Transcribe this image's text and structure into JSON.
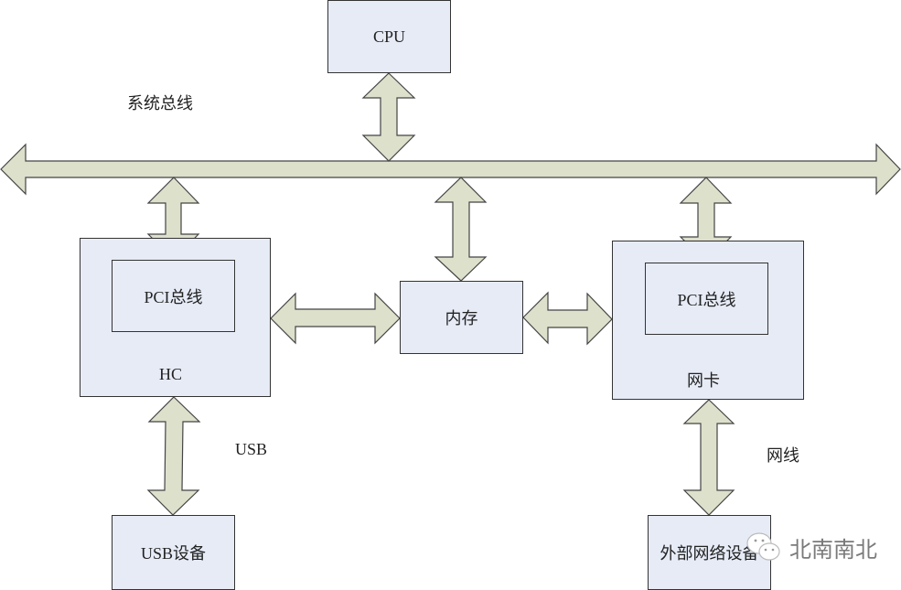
{
  "diagram": {
    "nodes": {
      "cpu": "CPU",
      "hc": "HC",
      "hc_pci": "PCI总线",
      "memory": "内存",
      "nic": "网卡",
      "nic_pci": "PCI总线",
      "usb_device": "USB设备",
      "external_net_device": "外部网络设备"
    },
    "labels": {
      "system_bus": "系统总线",
      "usb": "USB",
      "network_cable": "网线"
    },
    "edges": [
      {
        "from": "cpu",
        "to": "system_bus",
        "type": "bidirectional"
      },
      {
        "from": "system_bus",
        "to": "hc_pci",
        "type": "bidirectional"
      },
      {
        "from": "system_bus",
        "to": "memory",
        "type": "bidirectional"
      },
      {
        "from": "system_bus",
        "to": "nic_pci",
        "type": "bidirectional"
      },
      {
        "from": "hc",
        "to": "memory",
        "type": "bidirectional"
      },
      {
        "from": "memory",
        "to": "nic",
        "type": "bidirectional"
      },
      {
        "from": "hc",
        "to": "usb_device",
        "type": "bidirectional",
        "label": "USB"
      },
      {
        "from": "nic",
        "to": "external_net_device",
        "type": "bidirectional",
        "label": "网线"
      }
    ],
    "colors": {
      "box_fill": "#e6ebf6",
      "arrow_fill": "#dde0cb",
      "stroke": "#333333"
    }
  },
  "watermark": {
    "icon": "wechat-icon",
    "text": "北南南北"
  }
}
